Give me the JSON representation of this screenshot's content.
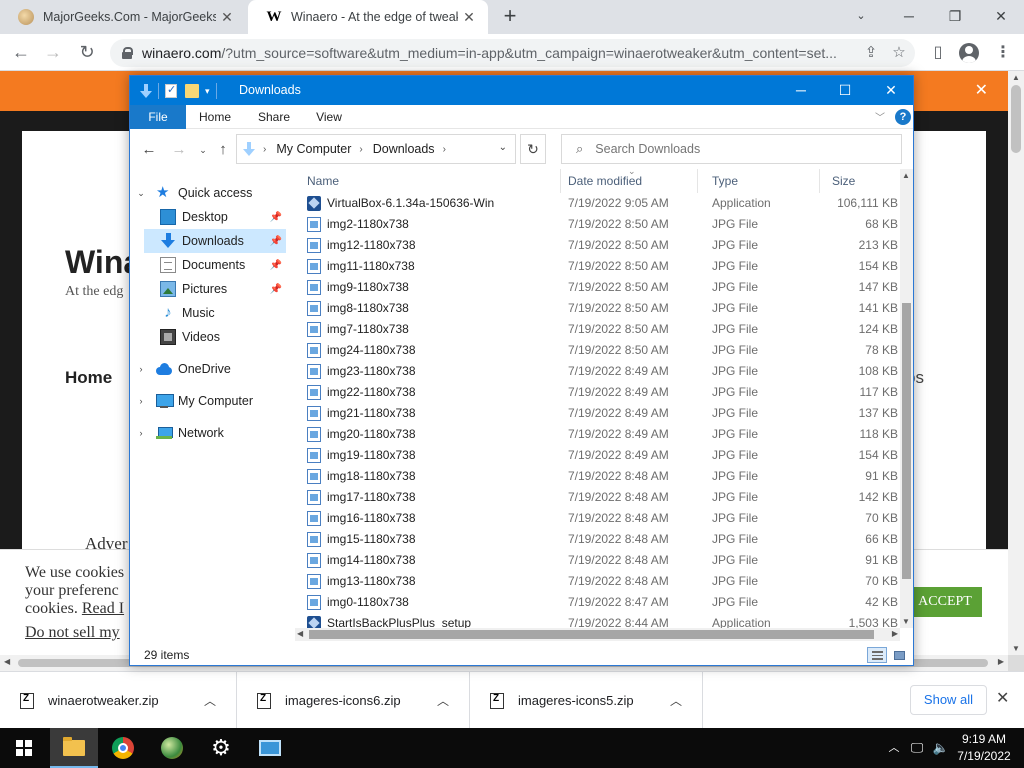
{
  "browser": {
    "tabs": [
      {
        "title": "MajorGeeks.Com - MajorGeeks",
        "active": false
      },
      {
        "title": "Winaero - At the edge of tweaking",
        "active": true,
        "favicon": "W"
      }
    ],
    "url_host": "winaero.com",
    "url_rest": "/?utm_source=software&utm_medium=in-app&utm_campaign=winaerotweaker&utm_content=set..."
  },
  "webpage": {
    "site_title": "Wina",
    "tagline": "At the edg",
    "home_menu": "Home",
    "menu_fragment": "ps",
    "adv": "Adver",
    "cookie_line1": "We use cookies",
    "cookie_line2": "your preferenc",
    "cookie_line3_prefix": "cookies.",
    "cookie_read_link": "Read I",
    "cookie_optout": "Do not sell my",
    "accept_label": "ACCEPT"
  },
  "explorer": {
    "title": "Downloads",
    "ribbon_tabs": [
      "File",
      "Home",
      "Share",
      "View"
    ],
    "breadcrumb": [
      "My Computer",
      "Downloads"
    ],
    "search_placeholder": "Search Downloads",
    "nav": {
      "quick_access": "Quick access",
      "desktop": "Desktop",
      "downloads": "Downloads",
      "documents": "Documents",
      "pictures": "Pictures",
      "music": "Music",
      "videos": "Videos",
      "onedrive": "OneDrive",
      "my_computer": "My Computer",
      "network": "Network"
    },
    "columns": {
      "name": "Name",
      "date": "Date modified",
      "type": "Type",
      "size": "Size"
    },
    "files": [
      {
        "name": "VirtualBox-6.1.34a-150636-Win",
        "date": "7/19/2022 9:05 AM",
        "type": "Application",
        "size": "106,111 KB",
        "icon": "app"
      },
      {
        "name": "img2-1180x738",
        "date": "7/19/2022 8:50 AM",
        "type": "JPG File",
        "size": "68 KB",
        "icon": "jpg"
      },
      {
        "name": "img12-1180x738",
        "date": "7/19/2022 8:50 AM",
        "type": "JPG File",
        "size": "213 KB",
        "icon": "jpg"
      },
      {
        "name": "img11-1180x738",
        "date": "7/19/2022 8:50 AM",
        "type": "JPG File",
        "size": "154 KB",
        "icon": "jpg"
      },
      {
        "name": "img9-1180x738",
        "date": "7/19/2022 8:50 AM",
        "type": "JPG File",
        "size": "147 KB",
        "icon": "jpg"
      },
      {
        "name": "img8-1180x738",
        "date": "7/19/2022 8:50 AM",
        "type": "JPG File",
        "size": "141 KB",
        "icon": "jpg"
      },
      {
        "name": "img7-1180x738",
        "date": "7/19/2022 8:50 AM",
        "type": "JPG File",
        "size": "124 KB",
        "icon": "jpg"
      },
      {
        "name": "img24-1180x738",
        "date": "7/19/2022 8:50 AM",
        "type": "JPG File",
        "size": "78 KB",
        "icon": "jpg"
      },
      {
        "name": "img23-1180x738",
        "date": "7/19/2022 8:49 AM",
        "type": "JPG File",
        "size": "108 KB",
        "icon": "jpg"
      },
      {
        "name": "img22-1180x738",
        "date": "7/19/2022 8:49 AM",
        "type": "JPG File",
        "size": "117 KB",
        "icon": "jpg"
      },
      {
        "name": "img21-1180x738",
        "date": "7/19/2022 8:49 AM",
        "type": "JPG File",
        "size": "137 KB",
        "icon": "jpg"
      },
      {
        "name": "img20-1180x738",
        "date": "7/19/2022 8:49 AM",
        "type": "JPG File",
        "size": "118 KB",
        "icon": "jpg"
      },
      {
        "name": "img19-1180x738",
        "date": "7/19/2022 8:49 AM",
        "type": "JPG File",
        "size": "154 KB",
        "icon": "jpg"
      },
      {
        "name": "img18-1180x738",
        "date": "7/19/2022 8:48 AM",
        "type": "JPG File",
        "size": "91 KB",
        "icon": "jpg"
      },
      {
        "name": "img17-1180x738",
        "date": "7/19/2022 8:48 AM",
        "type": "JPG File",
        "size": "142 KB",
        "icon": "jpg"
      },
      {
        "name": "img16-1180x738",
        "date": "7/19/2022 8:48 AM",
        "type": "JPG File",
        "size": "70 KB",
        "icon": "jpg"
      },
      {
        "name": "img15-1180x738",
        "date": "7/19/2022 8:48 AM",
        "type": "JPG File",
        "size": "66 KB",
        "icon": "jpg"
      },
      {
        "name": "img14-1180x738",
        "date": "7/19/2022 8:48 AM",
        "type": "JPG File",
        "size": "91 KB",
        "icon": "jpg"
      },
      {
        "name": "img13-1180x738",
        "date": "7/19/2022 8:48 AM",
        "type": "JPG File",
        "size": "70 KB",
        "icon": "jpg"
      },
      {
        "name": "img0-1180x738",
        "date": "7/19/2022 8:47 AM",
        "type": "JPG File",
        "size": "42 KB",
        "icon": "jpg"
      },
      {
        "name": "StartIsBackPlusPlus_setup",
        "date": "7/19/2022 8:44 AM",
        "type": "Application",
        "size": "1,503 KB",
        "icon": "app"
      }
    ],
    "item_count": "29 items"
  },
  "downloads_shelf": {
    "items": [
      "winaerotweaker.zip",
      "imageres-icons6.zip",
      "imageres-icons5.zip"
    ],
    "show_all": "Show all"
  },
  "taskbar": {
    "time": "9:19 AM",
    "date": "7/19/2022"
  }
}
